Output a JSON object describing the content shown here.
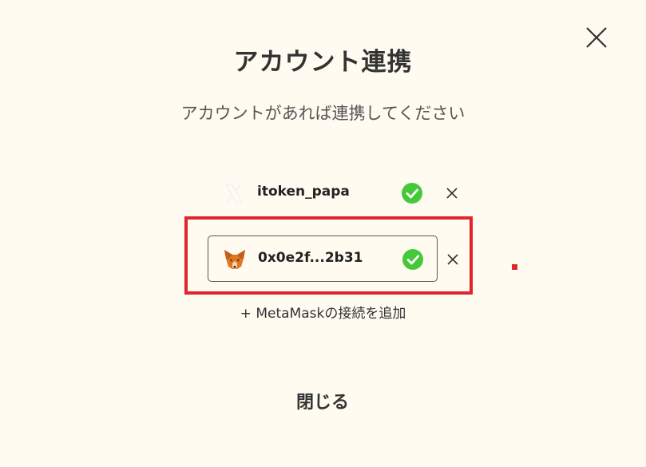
{
  "modal": {
    "title": "アカウント連携",
    "subtitle": "アカウントがあれば連携してください"
  },
  "accounts": [
    {
      "service_icon": "x-logo-icon",
      "name": "itoken_papa",
      "status_icon": "check-circle-icon",
      "remove_icon": "close-icon"
    },
    {
      "service_icon": "metamask-fox-icon",
      "name": "0x0e2f...2b31",
      "status_icon": "check-circle-icon",
      "remove_icon": "close-icon"
    }
  ],
  "add_metamask_label": "+ MetaMaskの接続を追加",
  "close_label": "閉じる",
  "colors": {
    "background": "#fffbf0",
    "check_green": "#45c93a",
    "highlight_red": "#e2242e",
    "text": "#333333"
  }
}
